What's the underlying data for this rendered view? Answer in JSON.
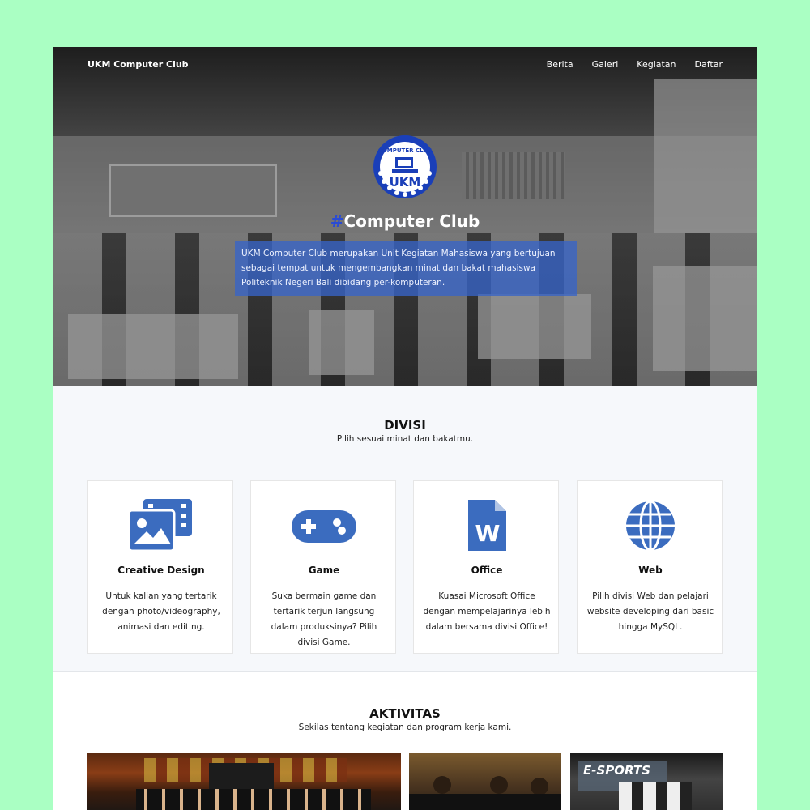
{
  "nav": {
    "brand": "UKM Computer Club",
    "links": [
      "Berita",
      "Galeri",
      "Kegiatan",
      "Daftar"
    ]
  },
  "hero": {
    "logo_text_top": "COMPUTER CLUB",
    "logo_text_main": "UKM",
    "title_hash": "#",
    "title": "Computer Club",
    "description": "UKM Computer Club merupakan Unit Kegiatan Mahasiswa yang bertujuan sebagai tempat untuk mengembangkan minat dan bakat mahasiswa Politeknik Negeri Bali dibidang per-komputeran."
  },
  "divisi": {
    "title": "DIVISI",
    "subtitle": "Pilih sesuai minat dan bakatmu.",
    "cards": [
      {
        "title": "Creative Design",
        "description": "Untuk kalian yang tertarik dengan photo/videography, animasi dan editing.",
        "icon": "photo-video-icon"
      },
      {
        "title": "Game",
        "description": "Suka bermain game dan tertarik terjun langsung dalam produksinya? Pilih divisi Game.",
        "icon": "gamepad-icon"
      },
      {
        "title": "Office",
        "description": "Kuasai Microsoft Office dengan mempelajarinya lebih dalam bersama divisi Office!",
        "icon": "word-file-icon"
      },
      {
        "title": "Web",
        "description": "Pilih divisi Web dan pelajari website developing dari basic hingga MySQL.",
        "icon": "globe-icon"
      }
    ]
  },
  "aktivitas": {
    "title": "AKTIVITAS",
    "subtitle": "Sekilas tentang kegiatan dan program kerja kami.",
    "photo3_text": "E-SPORTS"
  },
  "colors": {
    "accent": "#3b6cbf",
    "hero_box": "#3764c8",
    "page_bg": "#aaffc3"
  }
}
